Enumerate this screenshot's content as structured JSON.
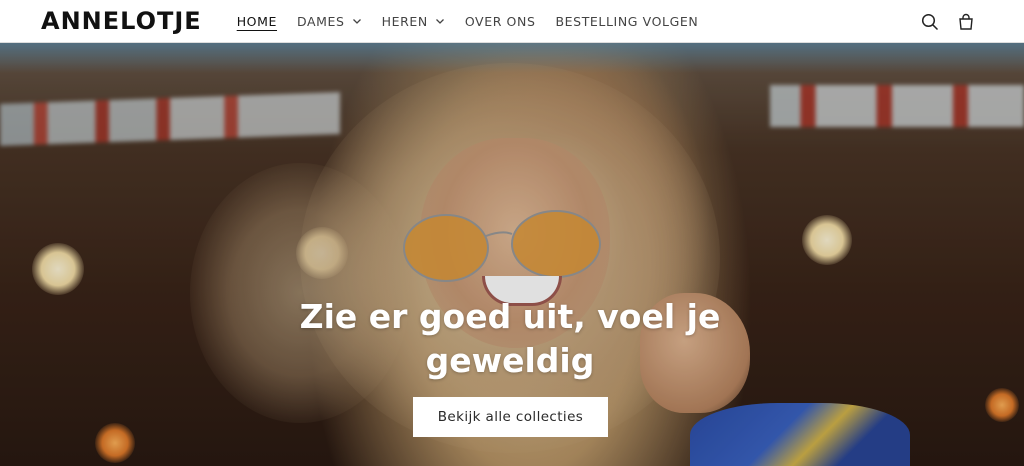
{
  "header": {
    "logo": "ANNELOTJE",
    "nav": [
      {
        "label": "HOME",
        "active": true,
        "dropdown": false
      },
      {
        "label": "DAMES",
        "active": false,
        "dropdown": true
      },
      {
        "label": "HEREN",
        "active": false,
        "dropdown": true
      },
      {
        "label": "OVER ONS",
        "active": false,
        "dropdown": false
      },
      {
        "label": "BESTELLING VOLGEN",
        "active": false,
        "dropdown": false
      }
    ],
    "icons": [
      "search-icon",
      "cart-icon"
    ]
  },
  "hero": {
    "headline": "Zie er goed uit, voel je geweldig",
    "cta_label": "Bekijk alle collecties"
  },
  "colors": {
    "text": "#121212",
    "background": "#ffffff",
    "button_bg": "#ffffff"
  }
}
